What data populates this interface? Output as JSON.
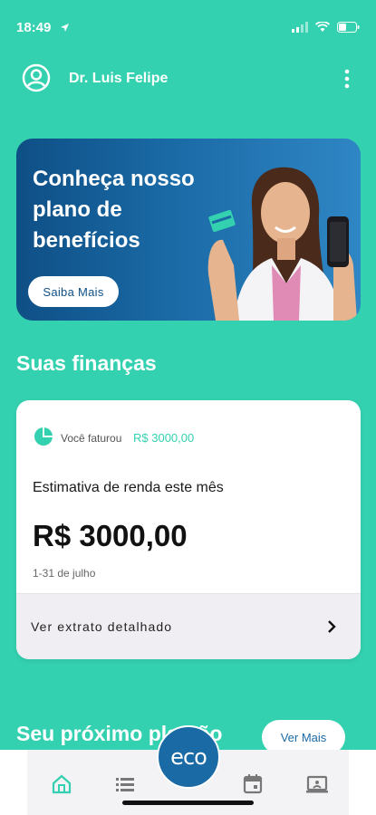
{
  "status_bar": {
    "time": "18:49"
  },
  "header": {
    "user_name": "Dr. Luis Felipe"
  },
  "banner": {
    "title": "Conheça nosso plano de benefícios",
    "button_label": "Saiba Mais"
  },
  "finances": {
    "section_title": "Suas finanças",
    "faturou_label": "Você faturou",
    "faturou_value": "R$ 3000,00",
    "estimativa_label": "Estimativa de renda este mês",
    "amount": "R$ 3000,00",
    "period": "1-31 de julho",
    "extrato_label": "Ver extrato detalhado"
  },
  "next_plan": {
    "title": "Seu próximo plantão",
    "button_label": "Ver Mais"
  },
  "bottom_nav": {
    "center_label": "eco",
    "items": [
      "home-icon",
      "list-icon",
      "calendar-icon",
      "screen-icon"
    ]
  },
  "colors": {
    "primary": "#34d1b0",
    "brand_blue": "#1a6aa6"
  }
}
